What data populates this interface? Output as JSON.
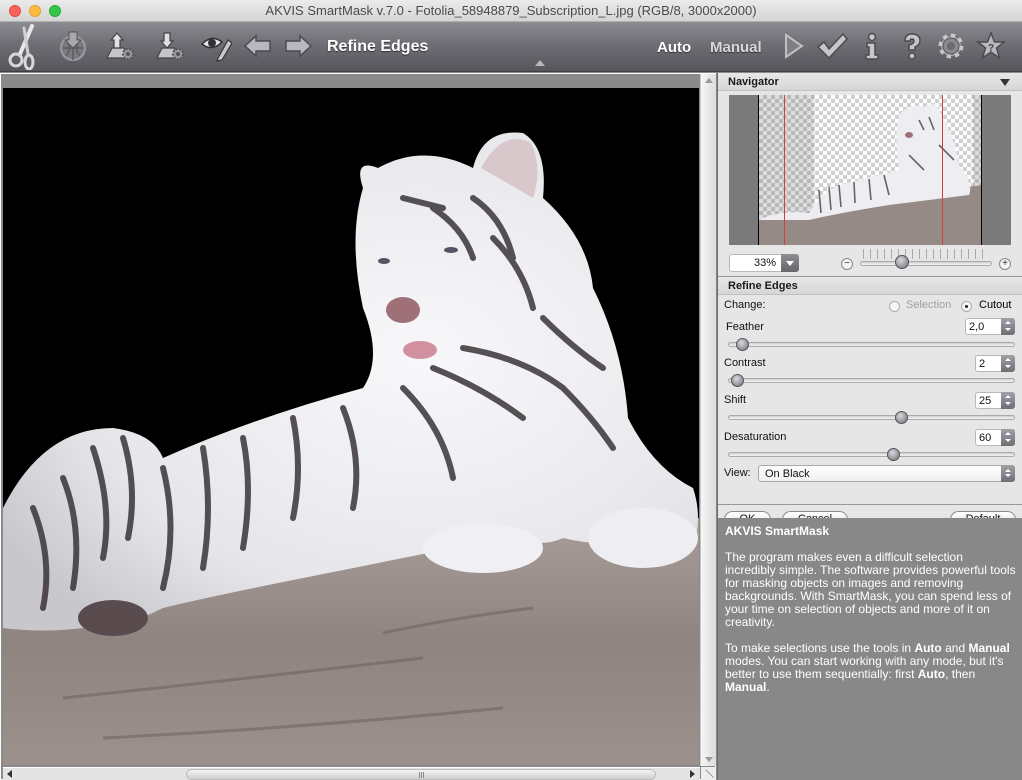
{
  "window": {
    "title": "AKVIS SmartMask v.7.0 - Fotolia_58948879_Subscription_L.jpg (RGB/8, 3000x2000)"
  },
  "toolbar": {
    "icons": [
      {
        "name": "scissors-logo-icon"
      },
      {
        "name": "open-image-icon"
      },
      {
        "name": "load-selection-icon"
      },
      {
        "name": "save-selection-icon"
      },
      {
        "name": "view-mask-icon"
      },
      {
        "name": "undo-icon"
      },
      {
        "name": "redo-icon"
      },
      {
        "name": "play-icon"
      },
      {
        "name": "apply-checkmark-icon"
      },
      {
        "name": "info-icon"
      },
      {
        "name": "help-icon"
      },
      {
        "name": "settings-gear-icon"
      },
      {
        "name": "tips-star-icon"
      }
    ],
    "title": "Refine Edges",
    "modes": {
      "auto": "Auto",
      "manual": "Manual"
    }
  },
  "navigator": {
    "header": "Navigator",
    "zoom_value": "33%",
    "zoom_slider_fraction": 0.3
  },
  "refine": {
    "header": "Refine Edges",
    "change_label": "Change:",
    "options": [
      {
        "label": "Selection",
        "selected": false,
        "enabled": false
      },
      {
        "label": "Cutout",
        "selected": true,
        "enabled": true
      }
    ],
    "params": [
      {
        "label": "Feather",
        "value": "2,0",
        "fraction": 0.03
      },
      {
        "label": "Contrast",
        "value": "2",
        "fraction": 0.01
      },
      {
        "label": "Shift",
        "value": "25",
        "fraction": 0.61
      },
      {
        "label": "Desaturation",
        "value": "60",
        "fraction": 0.58
      }
    ],
    "view_label": "View:",
    "view_value": "On Black",
    "buttons": {
      "ok": "OK",
      "cancel": "Cancel",
      "default": "Default"
    }
  },
  "help": {
    "title": "AKVIS SmartMask",
    "paragraph1": "The program makes even a difficult selection incredibly simple. The software provides powerful tools for masking objects on images and removing backgrounds. With SmartMask, you can spend less of your time on selection of objects and more of it on creativity.",
    "p2_part1": "To make selections use the tools in ",
    "p2_bold1": "Auto",
    "p2_part2": " and ",
    "p2_bold2": "Manual",
    "p2_part3": " modes. You can start working with any mode, but it's better to use them sequentially: first ",
    "p2_bold3": "Auto",
    "p2_part4": ", then ",
    "p2_bold4": "Manual",
    "p2_part5": "."
  },
  "canvas": {
    "background_label": "On Black",
    "image_description": "white tiger lying on a rock"
  }
}
